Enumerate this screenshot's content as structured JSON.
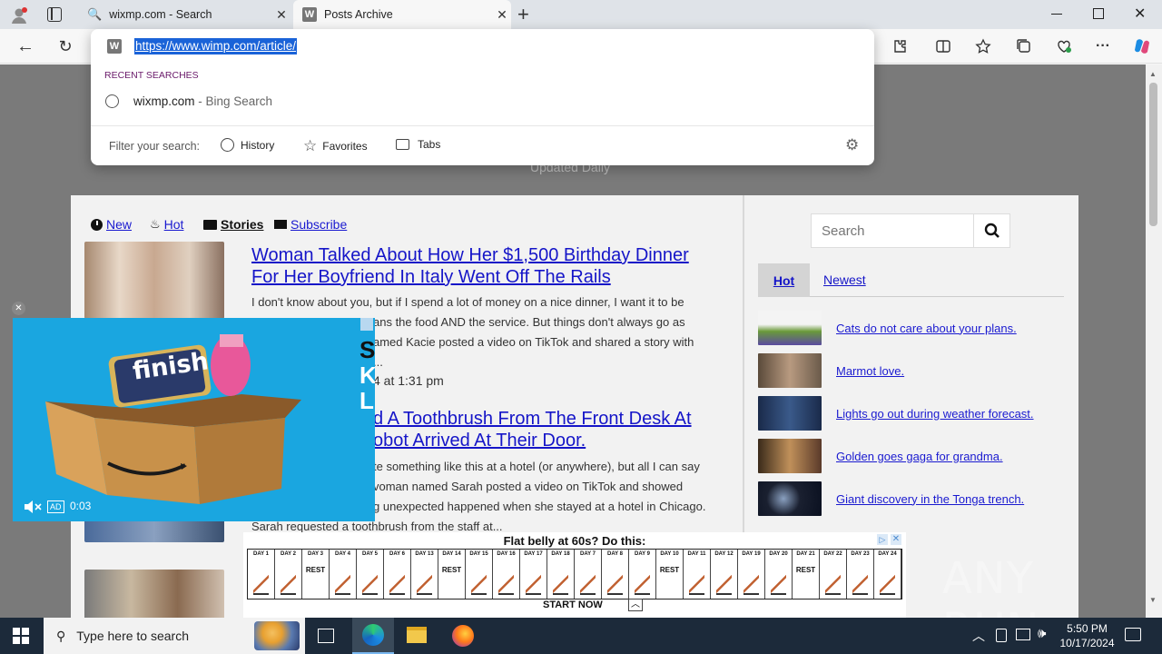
{
  "tabs": [
    {
      "title": "wixmp.com - Search",
      "icon": "search-icon"
    },
    {
      "title": "Posts Archive",
      "icon": "w-favicon"
    }
  ],
  "omnibox": {
    "url": "https://www.wimp.com/article/",
    "recent_label": "RECENT SEARCHES",
    "suggestion_main": "wixmp.com",
    "suggestion_sub": " - Bing Search",
    "filter_label": "Filter your search:",
    "filters": [
      "History",
      "Favorites",
      "Tabs"
    ]
  },
  "site": {
    "tagline": "Updated Daily",
    "nav": [
      "New",
      "Hot",
      "Stories",
      "Subscribe"
    ],
    "articles": [
      {
        "title": "Woman Talked About How Her $1,500 Birthday Dinner For Her Boyfriend In Italy Went Off The Rails",
        "body_lines": [
          "I don't know about you, but if I spend a lot of money on a nice dinner, I want it to be",
          "ans the food AND the service. But things don't always go as",
          "amed Kacie posted a video on TikTok and shared a story with",
          "..."
        ],
        "date": "4 at 1:31 pm"
      },
      {
        "title_lines": [
          "d A Toothbrush From The Front Desk At",
          "obot Arrived At Their Door."
        ],
        "body_lines": [
          "te something like this at a hotel (or anywhere), but all I can say",
          "voman named Sarah posted a video on TikTok and showed",
          "g unexpected happened when she stayed at a hotel in Chicago.",
          "Sarah requested a toothbrush from the staff at..."
        ]
      }
    ],
    "sidebar": {
      "search_placeholder": "Search",
      "tabs": [
        "Hot",
        "Newest"
      ],
      "items": [
        "Cats do not care about your plans.",
        "Marmot love.",
        "Lights go out during weather forecast.",
        "Golden goes gaga for grandma.",
        "Giant discovery in the Tonga trench."
      ]
    }
  },
  "video_ad": {
    "brand": "finish",
    "time": "0:03",
    "ad_badge": "AD",
    "side_letters": [
      "S",
      "K",
      "L"
    ]
  },
  "banner_ad": {
    "headline": "Flat belly at 60s? Do this:",
    "cta": "START NOW",
    "days": [
      "DAY 1",
      "DAY 2",
      "DAY 3",
      "DAY 4",
      "DAY 5",
      "DAY 6",
      "DAY 13",
      "DAY 14",
      "DAY 15",
      "DAY 16",
      "DAY 17",
      "DAY 18",
      "DAY 7",
      "DAY 8",
      "DAY 9",
      "DAY 10",
      "DAY 11",
      "DAY 12",
      "DAY 19",
      "DAY 20",
      "DAY 21",
      "DAY 22",
      "DAY 23",
      "DAY 24"
    ],
    "rest_days": [
      "DAY 3",
      "DAY 14",
      "DAY 10",
      "DAY 21"
    ],
    "rest_label": "REST"
  },
  "watermark": "ANY RUN",
  "taskbar": {
    "search_placeholder": "Type here to search",
    "time": "5:50 PM",
    "date": "10/17/2024"
  }
}
